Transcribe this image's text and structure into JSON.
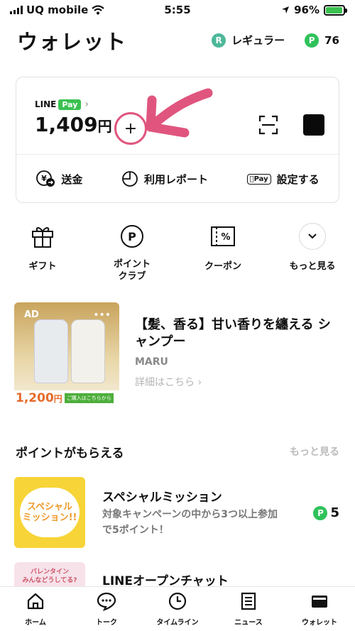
{
  "status_bar": {
    "carrier": "UQ mobile",
    "time": "5:55",
    "battery_pct": "96%",
    "battery_level": 0.96
  },
  "header": {
    "title": "ウォレット",
    "rank_badge": "R",
    "rank_label": "レギュラー",
    "points_badge": "P",
    "points": "76"
  },
  "pay_card": {
    "brand_line": "LINE",
    "brand_pay": "Pay",
    "chevron": "›",
    "balance": "1,409",
    "currency": "円",
    "add_symbol": "+",
    "actions": [
      {
        "icon": "yen-transfer-icon",
        "label": "送金"
      },
      {
        "icon": "report-chart-icon",
        "label": "利用レポート"
      },
      {
        "icon": "apple-pay-icon",
        "label": "設定する",
        "badge": "Pay"
      }
    ]
  },
  "quick_actions": [
    {
      "icon": "gift-icon",
      "label": "ギフト"
    },
    {
      "icon": "point-club-icon",
      "label": "ポイント\nクラブ",
      "icon_text": "P"
    },
    {
      "icon": "coupon-icon",
      "label": "クーポン",
      "icon_text": "%"
    },
    {
      "icon": "chevron-down-icon",
      "label": "もっと見る"
    }
  ],
  "ad": {
    "badge": "AD",
    "menu": "•••",
    "price": "1,200",
    "price_unit": "円",
    "cta": "ご購入はこちらから",
    "title": "【髪、香る】甘い香りを纏える シャンプー",
    "brand": "MARU",
    "link": "詳細はこちら ›"
  },
  "points_section": {
    "title": "ポイントがもらえる",
    "more": "もっと見る",
    "items": [
      {
        "image_text": "スペシャル\nミッション!!",
        "title": "スペシャルミッション",
        "desc": "対象キャンペーンの中から3つ以上参加で5ポイント！",
        "points_badge": "P",
        "points": "5"
      },
      {
        "image_text": "バレンタイン\nみんなどうしてる?",
        "title": "LINEオープンチャット"
      }
    ]
  },
  "tabbar": [
    {
      "icon": "home-icon",
      "label": "ホーム"
    },
    {
      "icon": "chat-icon",
      "label": "トーク"
    },
    {
      "icon": "clock-icon",
      "label": "タイムライン"
    },
    {
      "icon": "news-icon",
      "label": "ニュース"
    },
    {
      "icon": "wallet-icon",
      "label": "ウォレット"
    }
  ]
}
